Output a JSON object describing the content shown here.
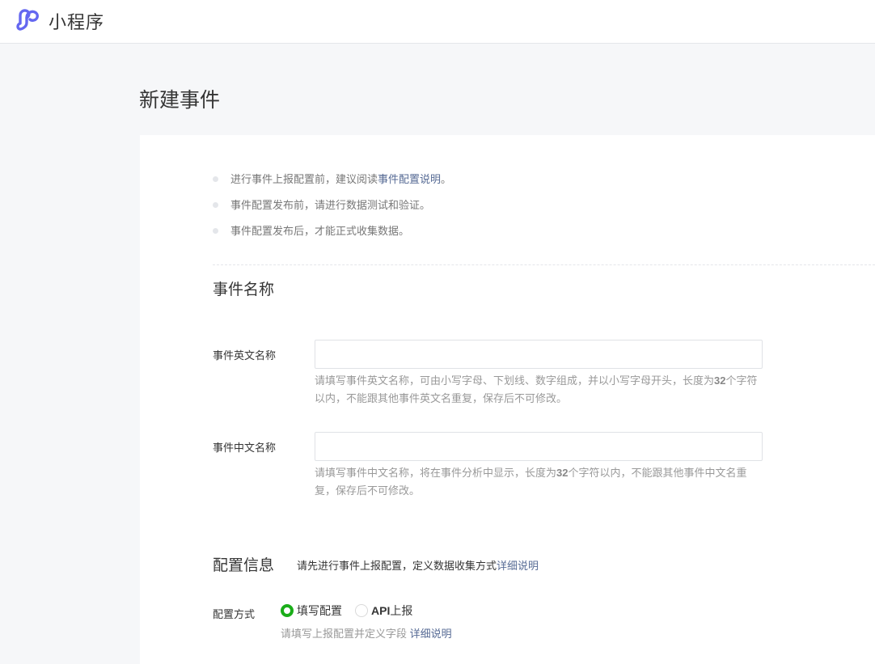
{
  "header": {
    "brand": "小程序",
    "logo_icon": "miniprogram-logo-icon",
    "accent_color": "#6467f0"
  },
  "page": {
    "title": "新建事件"
  },
  "tips": [
    {
      "text": "进行事件上报配置前，建议阅读",
      "link": "事件配置说明",
      "suffix": "。"
    },
    {
      "text": "事件配置发布前，请进行数据测试和验证。"
    },
    {
      "text": "事件配置发布后，才能正式收集数据。"
    }
  ],
  "event_name": {
    "section_title": "事件名称",
    "english": {
      "label": "事件英文名称",
      "value": "",
      "hint_part1": "请填写事件英文名称，可由小写字母、下划线、数字组成，并以小写字母开头，长度为",
      "hint_num": "32",
      "hint_part2": "个字符以内，不能跟其他事件英文名重复，保存后不可修改。"
    },
    "chinese": {
      "label": "事件中文名称",
      "value": "",
      "hint_part1": "请填写事件中文名称，将在事件分析中显示，长度为",
      "hint_num": "32",
      "hint_part2": "个字符以内，不能跟其他事件中文名重复，保存后不可修改。"
    }
  },
  "config": {
    "section_title": "配置信息",
    "desc": "请先进行事件上报配置，定义数据收集方式",
    "desc_link": "详细说明",
    "mode_label": "配置方式",
    "options": [
      {
        "label": "填写配置",
        "checked": true
      },
      {
        "label_bold": "API",
        "label": "上报",
        "checked": false
      }
    ],
    "mode_hint": "请填写上报配置并定义字段",
    "mode_hint_link": "详细说明",
    "checked_color": "#1aad19",
    "link_color": "#576b95"
  }
}
